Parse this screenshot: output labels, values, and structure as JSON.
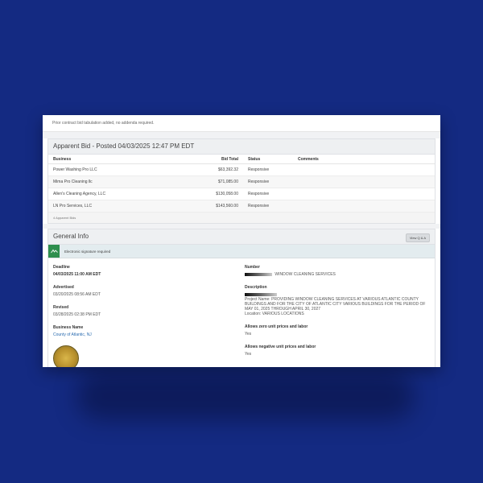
{
  "notice": "Prior contract bid tabulation added, no addenda required.",
  "apparent_bid": {
    "title": "Apparent Bid - Posted 04/03/2025 12:47 PM EDT",
    "columns": [
      "Business",
      "Bid Total",
      "Status",
      "Comments"
    ],
    "rows": [
      {
        "business": "Power Washing Pro LLC",
        "total": "$63,392.32",
        "status": "Responsive",
        "comments": ""
      },
      {
        "business": "Mima Pro Cleaning llc",
        "total": "$71,085.00",
        "status": "Responsive",
        "comments": ""
      },
      {
        "business": "Allen's Cleaning Agency, LLC",
        "total": "$130,058.00",
        "status": "Responsive",
        "comments": ""
      },
      {
        "business": "LN Pro Services, LLC",
        "total": "$143,560.00",
        "status": "Responsive",
        "comments": ""
      }
    ],
    "footnote": "4 Apparent Bids"
  },
  "general_info": {
    "title": "General Info",
    "view_button": "View Q & A",
    "signature_text": "Electronic signature required",
    "left": {
      "deadline_label": "Deadline",
      "deadline_value": "04/03/2025 11:00 AM EDT",
      "advertised_label": "Advertised",
      "advertised_value": "03/20/2025 08:56 AM EDT",
      "revised_label": "Revised",
      "revised_value": "03/28/2025 02:38 PM EDT",
      "business_label": "Business Name",
      "business_value": "County of Atlantic, NJ"
    },
    "right": {
      "number_label": "Number",
      "number_value": "WINDOW CLEANING SERVICES",
      "description_label": "Description",
      "description_value": "Project Name: PROVIDING WINDOW CLEANING SERVICES AT VARIOUS ATLANTIC COUNTY BUILDINGS AND FOR THE CITY OF ATLANTIC CITY VARIOUS BUILDINGS FOR THE PERIOD OF MAY 01, 2025 THROUGH APRIL 30, 2027",
      "location_value": "Location: VARIOUS LOCATIONS",
      "zero_label": "Allows zero unit prices and labor",
      "zero_value": "Yes",
      "negative_label": "Allows negative unit prices and labor",
      "negative_value": "Yes"
    }
  },
  "icons": {
    "signature": "signature-icon",
    "seal": "county-seal"
  },
  "colors": {
    "background": "#142a82",
    "signature_green": "#2f8f4e",
    "link": "#2b6cb0"
  }
}
